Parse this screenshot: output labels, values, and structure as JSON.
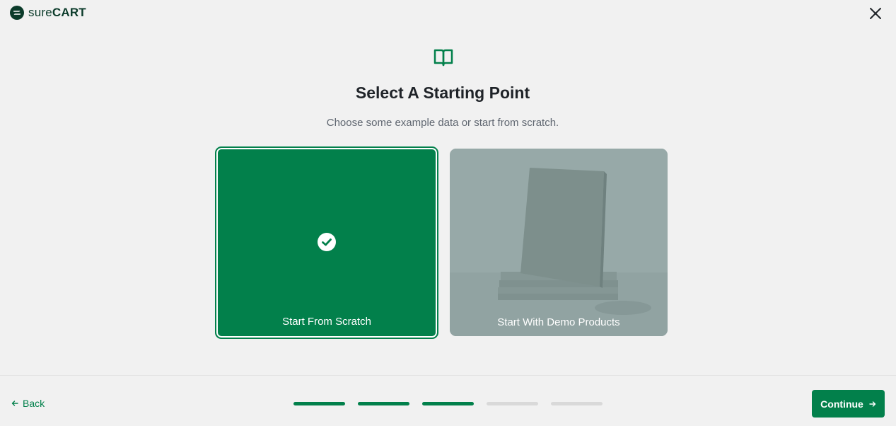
{
  "brand": {
    "name_part1": "sure",
    "name_part2": "CART"
  },
  "header": {
    "title": "Select A Starting Point",
    "subtitle": "Choose some example data or start from scratch."
  },
  "options": [
    {
      "label": "Start From Scratch",
      "selected": true
    },
    {
      "label": "Start With Demo Products",
      "selected": false
    }
  ],
  "footer": {
    "back_label": "Back",
    "continue_label": "Continue",
    "steps_total": 5,
    "steps_completed": 3
  },
  "colors": {
    "accent": "#02804b",
    "background": "#f1f1f1",
    "demo_card": "#96a8a8"
  },
  "icons": {
    "close": "close-icon",
    "book": "book-open-icon",
    "check": "check-circle-icon",
    "back": "arrow-left-icon",
    "continue": "arrow-right-icon"
  }
}
